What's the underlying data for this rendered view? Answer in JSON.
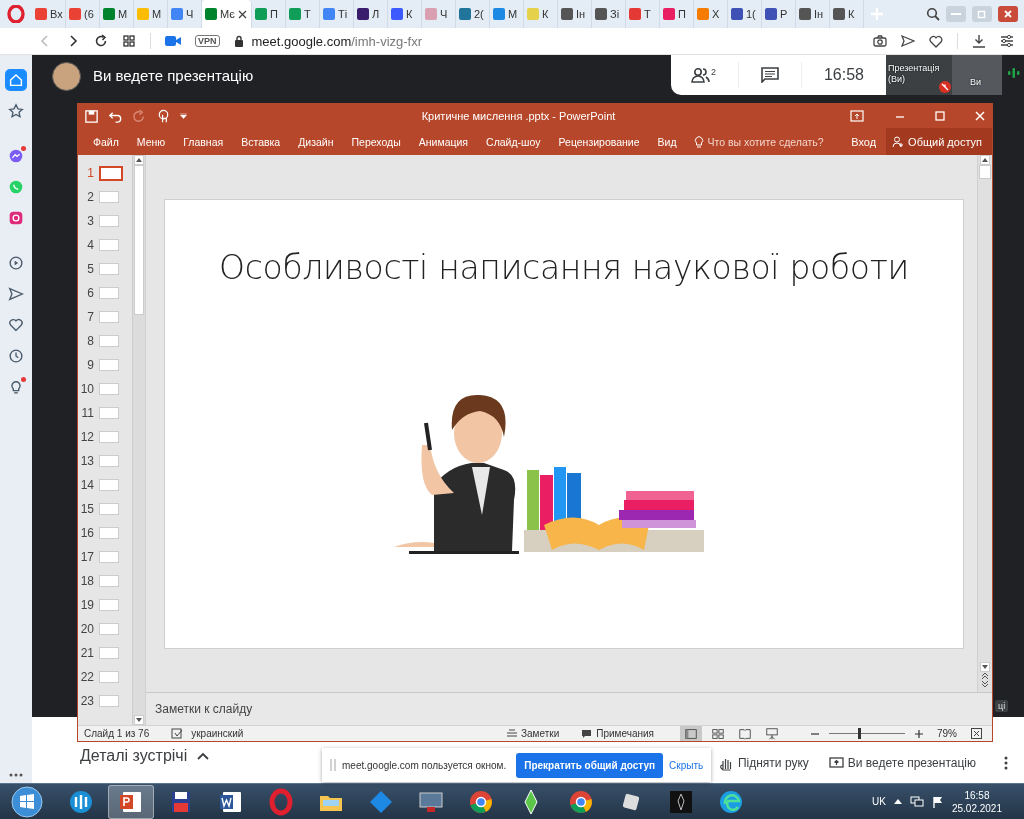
{
  "browser": {
    "tabs": [
      {
        "label": "Вх",
        "color": "#ea4335",
        "selected": false
      },
      {
        "label": "(6",
        "color": "#ea4335",
        "selected": false
      },
      {
        "label": "М",
        "color": "#00832d",
        "selected": false
      },
      {
        "label": "М",
        "color": "#fbbc04",
        "selected": false
      },
      {
        "label": "Ч",
        "color": "#4285f4",
        "selected": false
      },
      {
        "label": "Мє",
        "color": "#00832d",
        "selected": true
      },
      {
        "label": "П",
        "color": "#0f9d58",
        "selected": false
      },
      {
        "label": "Т",
        "color": "#0f9d58",
        "selected": false
      },
      {
        "label": "Ті",
        "color": "#4285f4",
        "selected": false
      },
      {
        "label": "Л",
        "color": "#3b1d6e",
        "selected": false
      },
      {
        "label": "К",
        "color": "#3d5afe",
        "selected": false
      },
      {
        "label": "Ч",
        "color": "#d8a0b0",
        "selected": false
      },
      {
        "label": "2(",
        "color": "#21759b",
        "selected": false
      },
      {
        "label": "М",
        "color": "#1e88e5",
        "selected": false
      },
      {
        "label": "К",
        "color": "#e6d24a",
        "selected": false
      },
      {
        "label": "Ін",
        "color": "#555555",
        "selected": false
      },
      {
        "label": "Зі",
        "color": "#555555",
        "selected": false
      },
      {
        "label": "Т",
        "color": "#e53935",
        "selected": false
      },
      {
        "label": "П",
        "color": "#e91e63",
        "selected": false
      },
      {
        "label": "Х",
        "color": "#f57c00",
        "selected": false
      },
      {
        "label": "1(",
        "color": "#3f51b5",
        "selected": false
      },
      {
        "label": "Р",
        "color": "#3f51b5",
        "selected": false
      },
      {
        "label": "Ін",
        "color": "#555555",
        "selected": false
      },
      {
        "label": "К",
        "color": "#555555",
        "selected": false
      }
    ],
    "nav": [
      {
        "kind": "back",
        "disabled": true
      },
      {
        "kind": "forward",
        "disabled": false
      },
      {
        "kind": "reload",
        "disabled": false
      },
      {
        "kind": "grid",
        "disabled": false
      }
    ],
    "vpn_badge": "VPN",
    "url_host": "meet.google.com",
    "url_path": "/imh-vizg-fxr"
  },
  "sidebar": {
    "items": [
      {
        "kind": "home",
        "selected": true,
        "notification": false
      },
      {
        "kind": "star",
        "selected": false,
        "notification": false
      },
      {
        "kind": "messenger",
        "selected": false,
        "notification": true
      },
      {
        "kind": "whatsapp",
        "selected": false,
        "notification": false
      },
      {
        "kind": "instagram",
        "selected": false,
        "notification": false
      },
      {
        "kind": "player",
        "selected": false,
        "notification": false
      },
      {
        "kind": "send",
        "selected": false,
        "notification": false
      },
      {
        "kind": "heart",
        "selected": false,
        "notification": false
      },
      {
        "kind": "clock",
        "selected": false,
        "notification": false
      },
      {
        "kind": "bulb",
        "selected": false,
        "notification": true
      }
    ]
  },
  "meet": {
    "banner": "Ви ведете презентацію",
    "participants_count": "2",
    "clock": "16:58",
    "tiles": [
      {
        "kind": "presentation",
        "label": "Презентація (Ви)",
        "muted": true
      },
      {
        "kind": "camera",
        "label": "Ви",
        "muted": false
      }
    ],
    "edge_label": "ці",
    "details": "Деталі зустрічі",
    "share_notice": {
      "text": "meet.google.com пользуется окном.",
      "stop_button": "Прекратить общий доступ",
      "hide_link": "Скрыть"
    },
    "actions": [
      {
        "kind": "hand",
        "label": "Підняти руку"
      },
      {
        "kind": "present",
        "label": "Ви ведете презентацію"
      }
    ]
  },
  "ppt": {
    "title": "Критичне мислення .pptx - PowerPoint",
    "quick_access": [
      {
        "kind": "save",
        "disabled": false
      },
      {
        "kind": "undo",
        "disabled": false
      },
      {
        "kind": "redo",
        "disabled": true
      },
      {
        "kind": "touch",
        "disabled": false
      }
    ],
    "ribbon_tabs": [
      "Файл",
      "Меню",
      "Главная",
      "Вставка",
      "Дизайн",
      "Переходы",
      "Анимация",
      "Слайд-шоу",
      "Рецензирование",
      "Вид"
    ],
    "tell_me": "Что вы хотите сделать?",
    "sign_in": "Вход",
    "share": "Общий доступ",
    "slides": [
      {
        "number": "1",
        "selected": true
      },
      {
        "number": "2",
        "selected": false
      },
      {
        "number": "3",
        "selected": false
      },
      {
        "number": "4",
        "selected": false
      },
      {
        "number": "5",
        "selected": false
      },
      {
        "number": "6",
        "selected": false
      },
      {
        "number": "7",
        "selected": false
      },
      {
        "number": "8",
        "selected": false
      },
      {
        "number": "9",
        "selected": false
      },
      {
        "number": "10",
        "selected": false
      },
      {
        "number": "11",
        "selected": false
      },
      {
        "number": "12",
        "selected": false
      },
      {
        "number": "13",
        "selected": false
      },
      {
        "number": "14",
        "selected": false
      },
      {
        "number": "15",
        "selected": false
      },
      {
        "number": "16",
        "selected": false
      },
      {
        "number": "17",
        "selected": false
      },
      {
        "number": "18",
        "selected": false
      },
      {
        "number": "19",
        "selected": false
      },
      {
        "number": "20",
        "selected": false
      },
      {
        "number": "21",
        "selected": false
      },
      {
        "number": "22",
        "selected": false
      },
      {
        "number": "23",
        "selected": false
      }
    ],
    "slide_title": "Особливості написання наукової роботи",
    "notes_placeholder": "Заметки к слайду",
    "status": {
      "slide_info": "Слайд 1 из 76",
      "language": "украинский",
      "notes": "Заметки",
      "comments": "Примечания",
      "views": [
        {
          "kind": "normal",
          "selected": true
        },
        {
          "kind": "sorter",
          "selected": false
        },
        {
          "kind": "reading",
          "selected": false
        },
        {
          "kind": "slideshow",
          "selected": false
        }
      ],
      "zoom": {
        "level": 0.4,
        "reading": "79%"
      }
    }
  },
  "taskbar": {
    "apps": [
      {
        "kind": "fan",
        "selected": false
      },
      {
        "kind": "powerpoint",
        "selected": true
      },
      {
        "kind": "floppy",
        "selected": false
      },
      {
        "kind": "word",
        "selected": false
      },
      {
        "kind": "opera",
        "selected": false
      },
      {
        "kind": "folder",
        "selected": false
      },
      {
        "kind": "diamond",
        "selected": false
      },
      {
        "kind": "monitor",
        "selected": false
      },
      {
        "kind": "chrome",
        "selected": false
      },
      {
        "kind": "plumbob",
        "selected": false
      },
      {
        "kind": "chrome",
        "selected": false
      },
      {
        "kind": "cube",
        "selected": false
      },
      {
        "kind": "dark",
        "selected": false
      },
      {
        "kind": "edge",
        "selected": false
      }
    ],
    "language": "UK",
    "time": "16:58",
    "date": "25.02.2021"
  }
}
